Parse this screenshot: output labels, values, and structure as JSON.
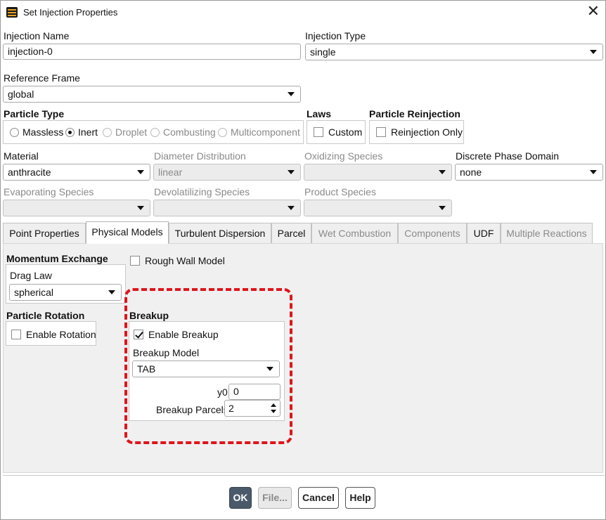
{
  "window": {
    "title": "Set Injection Properties"
  },
  "top": {
    "injection_name_label": "Injection Name",
    "injection_name_value": "injection-0",
    "injection_type_label": "Injection Type",
    "injection_type_value": "single",
    "reference_frame_label": "Reference Frame",
    "reference_frame_value": "global"
  },
  "particle_type": {
    "label": "Particle Type",
    "options": [
      "Massless",
      "Inert",
      "Droplet",
      "Combusting",
      "Multicomponent"
    ],
    "selected": "Inert"
  },
  "laws": {
    "label": "Laws",
    "custom_label": "Custom",
    "custom_checked": false
  },
  "reinjection": {
    "label": "Particle Reinjection",
    "only_label": "Reinjection Only",
    "only_checked": false
  },
  "material": {
    "material_label": "Material",
    "material_value": "anthracite",
    "diameter_label": "Diameter Distribution",
    "diameter_value": "linear",
    "oxidizing_label": "Oxidizing Species",
    "oxidizing_value": "",
    "domain_label": "Discrete Phase Domain",
    "domain_value": "none",
    "evaporating_label": "Evaporating Species",
    "devolatilizing_label": "Devolatilizing Species",
    "product_label": "Product Species"
  },
  "tabs": [
    "Point Properties",
    "Physical Models",
    "Turbulent Dispersion",
    "Parcel",
    "Wet Combustion",
    "Components",
    "UDF",
    "Multiple Reactions"
  ],
  "active_tab": "Physical Models",
  "physical_models": {
    "momentum_label": "Momentum Exchange",
    "drag_law_label": "Drag Law",
    "drag_law_value": "spherical",
    "rough_wall_label": "Rough Wall Model",
    "rough_wall_checked": false,
    "rotation_label": "Particle Rotation",
    "enable_rotation_label": "Enable Rotation",
    "enable_rotation_checked": false,
    "breakup_label": "Breakup",
    "enable_breakup_label": "Enable Breakup",
    "enable_breakup_checked": true,
    "breakup_model_label": "Breakup Model",
    "breakup_model_value": "TAB",
    "y0_label": "y0",
    "y0_value": "0",
    "parcels_label": "Breakup Parcels",
    "parcels_value": "2"
  },
  "buttons": {
    "ok": "OK",
    "file": "File...",
    "cancel": "Cancel",
    "help": "Help"
  },
  "colors": {
    "highlight": "#e0141b",
    "ok_button": "#4a5a6a"
  }
}
